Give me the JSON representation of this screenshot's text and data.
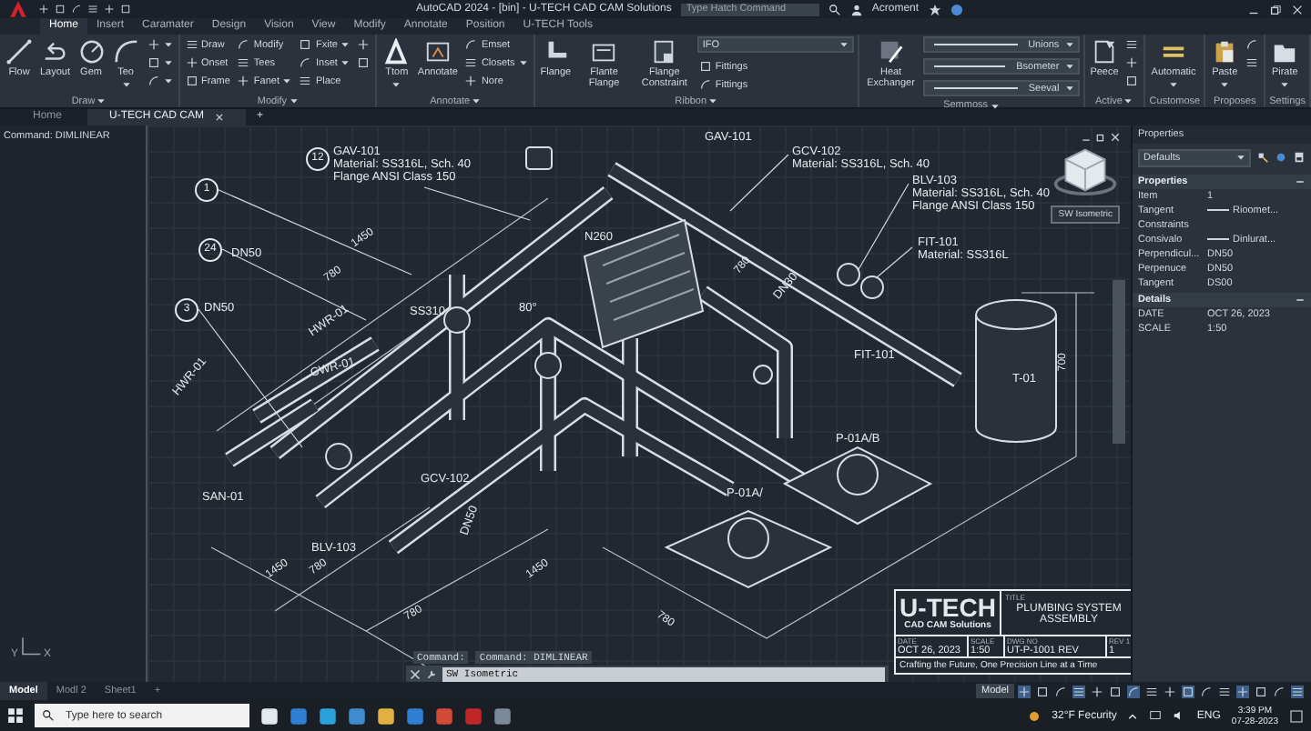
{
  "title_bar": {
    "title": "AutoCAD 2024 - [bin] - U-TECH CAD CAM Solutions",
    "search": {
      "placeholder": "Type Hatch Command"
    },
    "user": "Acroment"
  },
  "ribbon": {
    "tabs": [
      {
        "label": "Home",
        "selected": true
      },
      {
        "label": "Insert",
        "selected": false
      },
      {
        "label": "Caramater",
        "selected": false
      },
      {
        "label": "Design",
        "selected": false
      },
      {
        "label": "Vision",
        "selected": false
      },
      {
        "label": "View",
        "selected": false
      },
      {
        "label": "Modify",
        "selected": false
      },
      {
        "label": "Annotate",
        "selected": false
      },
      {
        "label": "Position",
        "selected": false
      },
      {
        "label": "U-TECH Tools",
        "selected": false
      }
    ],
    "groups": [
      {
        "label": "Draw",
        "menu": true,
        "items": [
          {
            "kind": "large",
            "label": "Flow",
            "caret": false
          },
          {
            "kind": "large",
            "label": "Layout",
            "caret": false
          },
          {
            "kind": "large",
            "label": "Gem",
            "caret": false
          },
          {
            "kind": "large",
            "label": "Teo",
            "caret": true
          },
          {
            "kind": "icon",
            "caret": true
          },
          {
            "kind": "icon",
            "caret": true
          },
          {
            "kind": "icon",
            "caret": true
          }
        ]
      },
      {
        "label": "Modify",
        "menu": true,
        "items": [
          {
            "kind": "small",
            "label": "Draw",
            "caret": false
          },
          {
            "kind": "small",
            "label": "Onset",
            "caret": false
          },
          {
            "kind": "small",
            "label": "Frame",
            "caret": false
          },
          {
            "kind": "small",
            "label": "Modify",
            "caret": false
          },
          {
            "kind": "small",
            "label": "Tees",
            "caret": false
          },
          {
            "kind": "small",
            "label": "Fanet",
            "caret": true
          },
          {
            "kind": "small",
            "label": "Fxite",
            "caret": true
          },
          {
            "kind": "small",
            "label": "Inset",
            "caret": true
          },
          {
            "kind": "small",
            "label": "Place",
            "caret": false
          },
          {
            "kind": "icon",
            "caret": false
          },
          {
            "kind": "icon",
            "caret": false
          }
        ]
      },
      {
        "label": "Annotate",
        "menu": true,
        "items": [
          {
            "kind": "large",
            "label": "Ttom",
            "caret": true
          },
          {
            "kind": "large",
            "label": "Annotate",
            "caret": false
          },
          {
            "kind": "small",
            "label": "Emset",
            "caret": false
          },
          {
            "kind": "small",
            "label": "Closets",
            "caret": true
          },
          {
            "kind": "small",
            "label": "Nore",
            "caret": false
          }
        ]
      },
      {
        "label": "Ribbon",
        "menu": true,
        "items": [
          {
            "kind": "large",
            "label": "Flange",
            "caret": false
          },
          {
            "kind": "large",
            "label": "Flante Flange",
            "caret": false
          },
          {
            "kind": "large",
            "label": "Flange Constraint",
            "caret": false
          },
          {
            "kind": "dropdown",
            "value": "IFO"
          },
          {
            "kind": "small",
            "label": "Fittings",
            "caret": false
          },
          {
            "kind": "small",
            "label": "Fittings",
            "caret": false
          }
        ]
      },
      {
        "label": "Semmoss",
        "menu": true,
        "items": [
          {
            "kind": "large",
            "label": "Heat Exchanger",
            "caret": false
          },
          {
            "kind": "dropdown",
            "value": "Unions"
          },
          {
            "kind": "dropdown",
            "value": "Bsometer"
          },
          {
            "kind": "dropdown",
            "value": "Seeval"
          }
        ]
      },
      {
        "label": "Active",
        "menu": true,
        "items": [
          {
            "kind": "large",
            "label": "Peece",
            "caret": false
          },
          {
            "kind": "icon",
            "caret": false
          },
          {
            "kind": "icon",
            "caret": false
          },
          {
            "kind": "icon",
            "caret": false
          }
        ]
      },
      {
        "label": "Customose",
        "menu": false,
        "items": [
          {
            "kind": "large",
            "label": "Automatic",
            "caret": true
          }
        ]
      },
      {
        "label": "Proposes",
        "menu": false,
        "items": [
          {
            "kind": "large",
            "label": "Paste",
            "caret": true
          },
          {
            "kind": "icon",
            "caret": false
          },
          {
            "kind": "icon",
            "caret": false
          }
        ]
      },
      {
        "label": "Settings",
        "menu": false,
        "items": [
          {
            "kind": "large",
            "label": "Pirate",
            "caret": true
          }
        ]
      }
    ]
  },
  "document_tabs": [
    {
      "label": "Home",
      "selected": false,
      "closable": false
    },
    {
      "label": "U-TECH CAD CAM",
      "selected": true,
      "closable": true
    }
  ],
  "new_tab": "+",
  "command_panel": {
    "text": "Command: DIMLINEAR",
    "ucs": {
      "y_label": "Y",
      "x_label": "X"
    }
  },
  "drawing": {
    "labels": [
      {
        "kind": "balloon",
        "text": "12"
      },
      {
        "kind": "callout",
        "lines": [
          "GAV-101",
          "Material: SS316L, Sch. 40",
          "Flange ANSI Class 150"
        ]
      },
      {
        "kind": "balloon",
        "text": "1"
      },
      {
        "kind": "balloon",
        "text": "24"
      },
      {
        "kind": "tag",
        "text": "DN50"
      },
      {
        "kind": "balloon",
        "text": "3"
      },
      {
        "kind": "tag",
        "text": "DN50"
      },
      {
        "kind": "dim",
        "text": "1450"
      },
      {
        "kind": "dim",
        "text": "780"
      },
      {
        "kind": "tag",
        "text": "HWR-01"
      },
      {
        "kind": "tag",
        "text": "SS310"
      },
      {
        "kind": "tag",
        "text": "CWR-01"
      },
      {
        "kind": "tag",
        "text": "N260"
      },
      {
        "kind": "tag",
        "text": "80°"
      },
      {
        "kind": "tag",
        "text": "GAV-101"
      },
      {
        "kind": "callout",
        "lines": [
          "GCV-102",
          "Material: SS316L, Sch. 40"
        ]
      },
      {
        "kind": "callout",
        "lines": [
          "BLV-103",
          "Material: SS316L, Sch. 40",
          "Flange ANSI Class 150"
        ]
      },
      {
        "kind": "callout",
        "lines": [
          "FIT-101",
          "Material: SS316L"
        ]
      },
      {
        "kind": "dim",
        "text": "780"
      },
      {
        "kind": "tag",
        "text": "DN30"
      },
      {
        "kind": "tag",
        "text": "FIT-101"
      },
      {
        "kind": "tag",
        "text": "T-01"
      },
      {
        "kind": "dim",
        "text": "700"
      },
      {
        "kind": "tag",
        "text": "HWR-01"
      },
      {
        "kind": "tag",
        "text": "SAN-01"
      },
      {
        "kind": "tag",
        "text": "BLV-103"
      },
      {
        "kind": "tag",
        "text": "GCV-102"
      },
      {
        "kind": "tag",
        "text": "DN50"
      },
      {
        "kind": "tag",
        "text": "P-01A/B"
      },
      {
        "kind": "tag",
        "text": "P-01A/"
      },
      {
        "kind": "dim",
        "text": "1450"
      },
      {
        "kind": "dim",
        "text": "780"
      },
      {
        "kind": "dim",
        "text": "780"
      },
      {
        "kind": "dim",
        "text": "1450"
      },
      {
        "kind": "dim",
        "text": "780"
      }
    ],
    "view_label": "SW Isometric"
  },
  "title_block": {
    "company": "U-TECH",
    "subtitle": "CAD CAM Solutions",
    "title_caption": "TITLE",
    "title": "PLUMBING SYSTEM ASSEMBLY",
    "fields": [
      {
        "caption": "DATE",
        "value": "OCT 26, 2023"
      },
      {
        "caption": "SCALE",
        "value": "1:50"
      },
      {
        "caption": "DWG NO",
        "value": "UT-P-1001 REV"
      },
      {
        "caption": "REV 1",
        "value": "1"
      }
    ],
    "tagline": "Crafting the Future, One Precision Line at a Time"
  },
  "command_line": {
    "history": [
      "Command:",
      "Command: DIMLINEAR"
    ],
    "value": "SW Isometric"
  },
  "properties_panel": {
    "title": "Properties",
    "selector": "Defaults",
    "sections": [
      {
        "title": "Properties",
        "expanded": true,
        "rows": [
          {
            "name": "Item",
            "value": "1",
            "line": false
          },
          {
            "name": "Tangent",
            "value": "Rioomet...",
            "line": true
          },
          {
            "name": "Constraints",
            "line": false
          },
          {
            "name": "Consivalo",
            "value": "Dinlurat...",
            "line": true
          },
          {
            "name": "Perpendicul...",
            "value": "DN50",
            "line": false
          },
          {
            "name": "Perpenuce",
            "value": "DN50",
            "line": false
          },
          {
            "name": "Tangent",
            "value": "DS00",
            "line": false
          }
        ]
      },
      {
        "title": "Details",
        "expanded": true,
        "rows": [
          {
            "name": "DATE",
            "value": "OCT 26, 2023",
            "line": false
          },
          {
            "name": "SCALE",
            "value": "1:50",
            "line": false
          }
        ]
      }
    ]
  },
  "status_bar": {
    "layout_tabs": [
      {
        "label": "Model",
        "selected": true
      },
      {
        "label": "Modl 2",
        "selected": false
      },
      {
        "label": "Sheet1",
        "selected": false
      }
    ],
    "add": "+",
    "space": "Model"
  },
  "taskbar": {
    "search": {
      "placeholder": "Type here to search"
    },
    "weather": "32°F Fecurity",
    "language": "ENG",
    "time": "3:39 PM",
    "date": "07-28-2023"
  }
}
